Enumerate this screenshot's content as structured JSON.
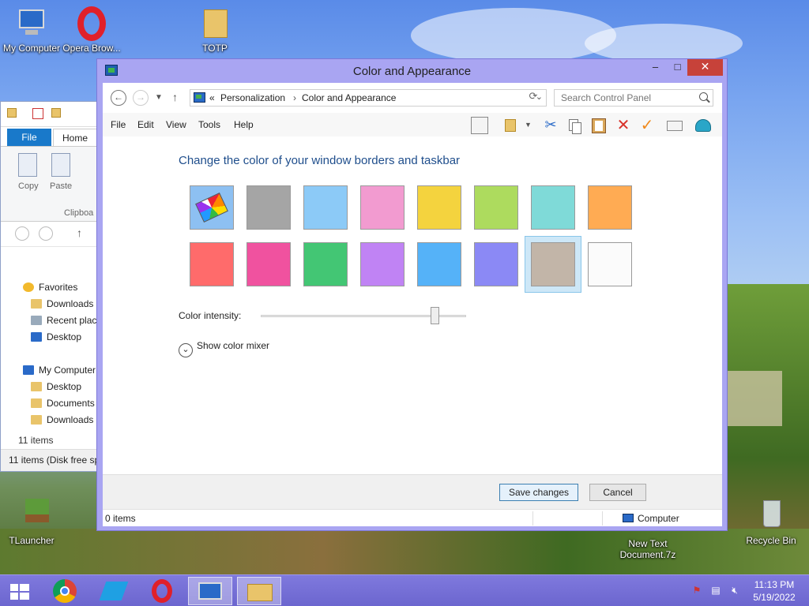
{
  "desktop": {
    "icons": [
      {
        "label": "My Computer"
      },
      {
        "label": "Opera Brow..."
      },
      {
        "label": "TOTP"
      },
      {
        "label": "TLauncher"
      },
      {
        "label": "New Text Document.7z"
      },
      {
        "label": "Recycle Bin"
      }
    ]
  },
  "explorer": {
    "tabs": {
      "file": "File",
      "home": "Home"
    },
    "ribbon": {
      "copy": "Copy",
      "paste": "Paste",
      "clipboard": "Clipboa"
    },
    "tree": {
      "favorites": "Favorites",
      "downloads": "Downloads",
      "recent": "Recent plac",
      "desktop": "Desktop",
      "my_computer": "My Computer",
      "desktop2": "Desktop",
      "documents": "Documents",
      "downloads2": "Downloads"
    },
    "count": "11 items",
    "status": "11 items (Disk free sp"
  },
  "window": {
    "title": "Color and Appearance",
    "controls": {
      "minimize": "–",
      "maximize": "□",
      "close": "✕"
    },
    "address": {
      "prefix": "«",
      "crumbs": [
        "Personalization",
        "Color and Appearance"
      ],
      "separator": "›"
    },
    "search": {
      "placeholder": "Search Control Panel"
    },
    "menu": [
      "File",
      "Edit",
      "View",
      "Tools",
      "Help"
    ],
    "heading": "Change the color of your window borders and taskbar",
    "colors": {
      "row1": [
        "#auto",
        "#a5a5a5",
        "#8ccaf7",
        "#f29bd0",
        "#f4d33e",
        "#addb5e",
        "#7fdad8",
        "#ffab53"
      ],
      "row2": [
        "#ff6b6b",
        "#f0529f",
        "#43c674",
        "#c083f4",
        "#55b2f8",
        "#8b89f5",
        "#c2b5a8",
        "#fbfbfb"
      ],
      "selected_row": 2,
      "selected_index": 6
    },
    "intensity": {
      "label": "Color intensity:",
      "value": 0.85
    },
    "mixer": "Show color mixer",
    "buttons": {
      "save": "Save changes",
      "cancel": "Cancel"
    },
    "statusbar": {
      "left": "0 items",
      "right": "Computer"
    }
  },
  "taskbar": {
    "clock": {
      "time": "11:13 PM",
      "date": "5/19/2022"
    }
  },
  "accent": "#8b89f5"
}
